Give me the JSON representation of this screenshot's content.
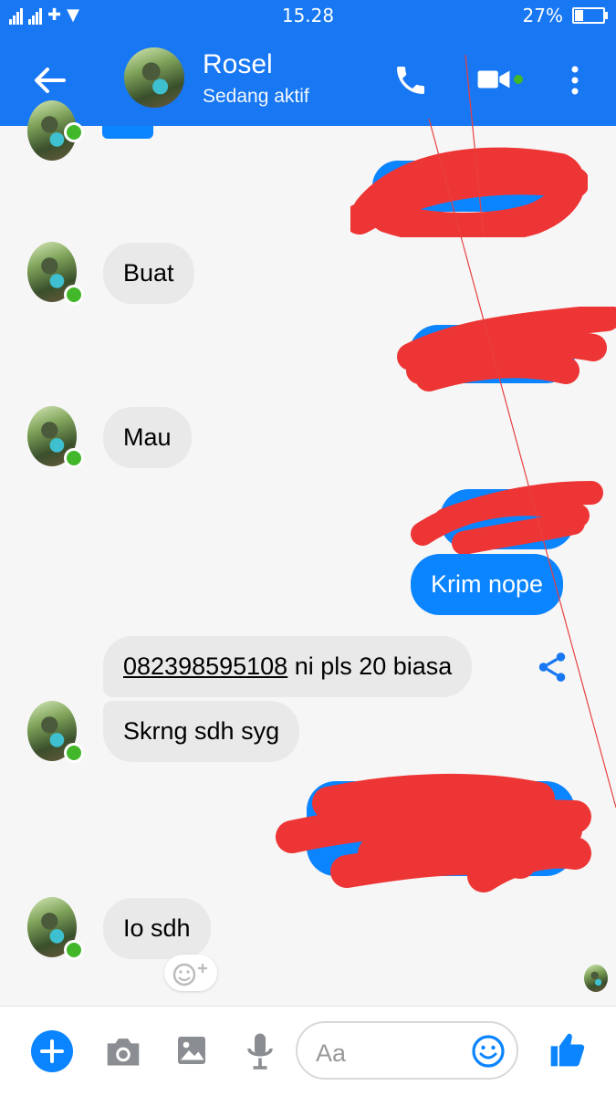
{
  "status_bar": {
    "carrier_icons": "signal-icons",
    "time": "15.28",
    "battery_percent": "27%",
    "battery_level": 0.27
  },
  "header": {
    "contact_name": "Rosel",
    "contact_status": "Sedang aktif"
  },
  "messages": [
    {
      "id": "m1",
      "from": "me",
      "text": "",
      "redacted": true
    },
    {
      "id": "m2",
      "from": "them",
      "text": "Buat"
    },
    {
      "id": "m3",
      "from": "me",
      "text": "",
      "redacted": true
    },
    {
      "id": "m4",
      "from": "them",
      "text": "Mau"
    },
    {
      "id": "m5",
      "from": "me",
      "text": "",
      "redacted": true
    },
    {
      "id": "m6",
      "from": "me",
      "text": "Krim nope"
    },
    {
      "id": "m7",
      "from": "them",
      "phone": "082398595108",
      "text": " ni pls 20 biasa"
    },
    {
      "id": "m8",
      "from": "them",
      "text": "Skrng sdh syg"
    },
    {
      "id": "m9",
      "from": "me",
      "text": "",
      "redacted": true
    },
    {
      "id": "m10",
      "from": "them",
      "text": "Io sdh"
    }
  ],
  "composer": {
    "placeholder": "Aa"
  },
  "colors": {
    "brand": "#1877f2",
    "outgoing_bubble": "#0a84ff",
    "incoming_bubble": "#e9e9e9",
    "online": "#42b72a",
    "redaction": "#ee3535"
  }
}
